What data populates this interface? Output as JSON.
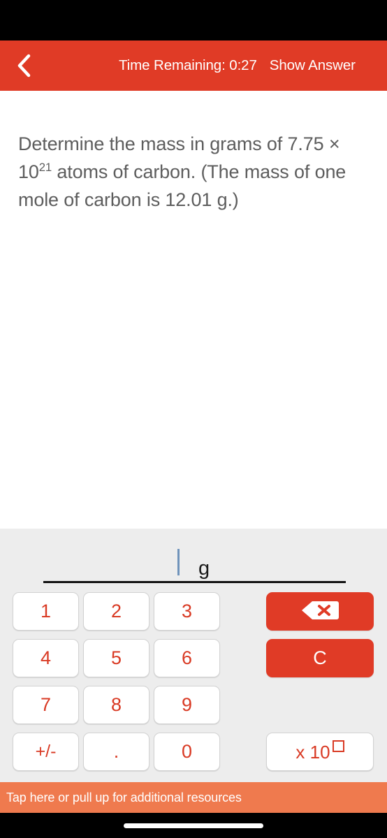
{
  "header": {
    "back_icon": "chevron-left-icon",
    "timer_label": "Time Remaining: 0:27",
    "show_answer_label": "Show Answer",
    "background_color": "#E03B26"
  },
  "question": {
    "line1": "Determine the mass in grams of",
    "line2_prefix": "7.75 × 10",
    "line2_exponent": "21",
    "line2_suffix": " atoms of carbon. (The",
    "line3": "mass of one mole of carbon is 12.01",
    "line4": "g.)",
    "full_text": "Determine the mass in grams of 7.75 × 10²¹ atoms of carbon. (The mass of one mole of carbon is 12.01 g.)"
  },
  "answer": {
    "value": "",
    "unit": "g",
    "caret_visible": "true",
    "caret_color": "#6f93bb"
  },
  "keypad": {
    "keys": [
      {
        "label": "1",
        "name": "key-1"
      },
      {
        "label": "2",
        "name": "key-2"
      },
      {
        "label": "3",
        "name": "key-3"
      },
      {
        "label": "4",
        "name": "key-4"
      },
      {
        "label": "5",
        "name": "key-5"
      },
      {
        "label": "6",
        "name": "key-6"
      },
      {
        "label": "7",
        "name": "key-7"
      },
      {
        "label": "8",
        "name": "key-8"
      },
      {
        "label": "9",
        "name": "key-9"
      },
      {
        "label": "+/-",
        "name": "key-sign"
      },
      {
        "label": ".",
        "name": "key-decimal"
      },
      {
        "label": "0",
        "name": "key-0"
      }
    ],
    "digit_color": "#D93A24",
    "key_background": "#ffffff",
    "panel_background": "#ededed"
  },
  "actions": {
    "backspace_icon": "backspace-icon",
    "clear_label": "C",
    "exponent_prefix": "x 10",
    "exponent_placeholder": "□",
    "accent_color": "#E03B26"
  },
  "footer": {
    "resources_label": "Tap here or pull up for additional resources",
    "background_color": "#EF7A4E",
    "home_indicator": "home-indicator"
  }
}
